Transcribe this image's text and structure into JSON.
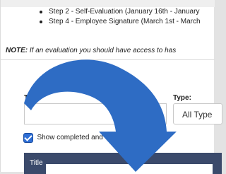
{
  "steps": [
    "Step 2 - Self-Evaluation (January 16th - January",
    "Step 4 - Employee Signature (March 1st - March"
  ],
  "note": {
    "label": "NOTE:",
    "text": " If an evaluation you should have access to has"
  },
  "filters": {
    "title_label": "Title",
    "title_value": "",
    "type_label": "Type:",
    "type_value": "All Type",
    "show_completed_label": "Show completed and exp",
    "show_completed_checked": true
  },
  "table": {
    "columns": [
      "Title"
    ]
  },
  "colors": {
    "arrow": "#2e6cc4",
    "table_header": "#3b4a6b",
    "checkbox": "#2f6fd6"
  },
  "icons": {
    "overlay": "curved-down-arrow-icon"
  }
}
